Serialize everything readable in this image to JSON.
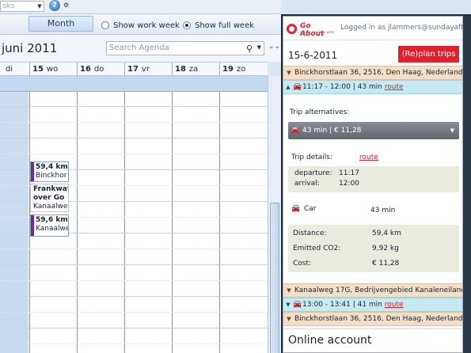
{
  "ribbon": {
    "search_placeholder": "oks",
    "help_icon": "help-icon",
    "help_glyph": "?"
  },
  "view": {
    "month_tab": "Month",
    "show_work_week": "Show work week",
    "show_full_week": "Show full week",
    "selected": "full_week"
  },
  "agenda": {
    "date_title": "juni 2011",
    "search_placeholder": "Search Agenda",
    "days": [
      {
        "num": "",
        "name": "di"
      },
      {
        "num": "15",
        "name": "wo"
      },
      {
        "num": "16",
        "name": "do"
      },
      {
        "num": "17",
        "name": "vr"
      },
      {
        "num": "18",
        "name": "za"
      },
      {
        "num": "19",
        "name": "zo"
      }
    ],
    "appointments": [
      {
        "line1": "59,4 km t",
        "line2": "Binckhor"
      },
      {
        "line1": "Frankwat",
        "line2": "over Go",
        "line3": "Kanaalwe"
      },
      {
        "line1": "59,6 km t",
        "line2": "Kanaalwe"
      }
    ]
  },
  "panel": {
    "logo_brand": "Go About",
    "logo_tag": "makes your day work",
    "logged_in": "Logged in as jlammers@sundayafternc",
    "date": "15-6-2011",
    "replan_label": "(Re)plan trips",
    "origin": "Binckhorstlaan 36, 2516, Den Haag, Nederland",
    "trip1": {
      "time": "11:17 - 12:00 | 43 min",
      "route": "route"
    },
    "trip_alternatives_label": "Trip alternatives:",
    "alternative_value": "43 min  |  € 11,28",
    "trip_details_label": "Trip details:",
    "trip_details_route": "route",
    "departure_label": "departure:",
    "departure_value": "11:17",
    "arrival_label": "arrival:",
    "arrival_value": "12:00",
    "mode_label": "Car",
    "mode_duration": "43 min",
    "distance_label": "Distance:",
    "distance_value": "59,4 km",
    "co2_label": "Emitted CO2:",
    "co2_value": "9,92 kg",
    "cost_label": "Cost:",
    "cost_value": "€ 11,28",
    "stop2": "Kanaalweg 17G, Bedrijvengebied Kanaleneiland",
    "trip2": {
      "time": "13:00 - 13:41 | 41 min",
      "route": "route"
    },
    "stop3": "Binckhorstlaan 36, 2516, Den Haag, Nederland",
    "online_account": "Online account"
  },
  "colors": {
    "accent_red": "#e21f2d",
    "address_bar": "#f3dfc5",
    "trip_bar": "#c5eaf1",
    "appointment_bar": "#6c2c93"
  }
}
